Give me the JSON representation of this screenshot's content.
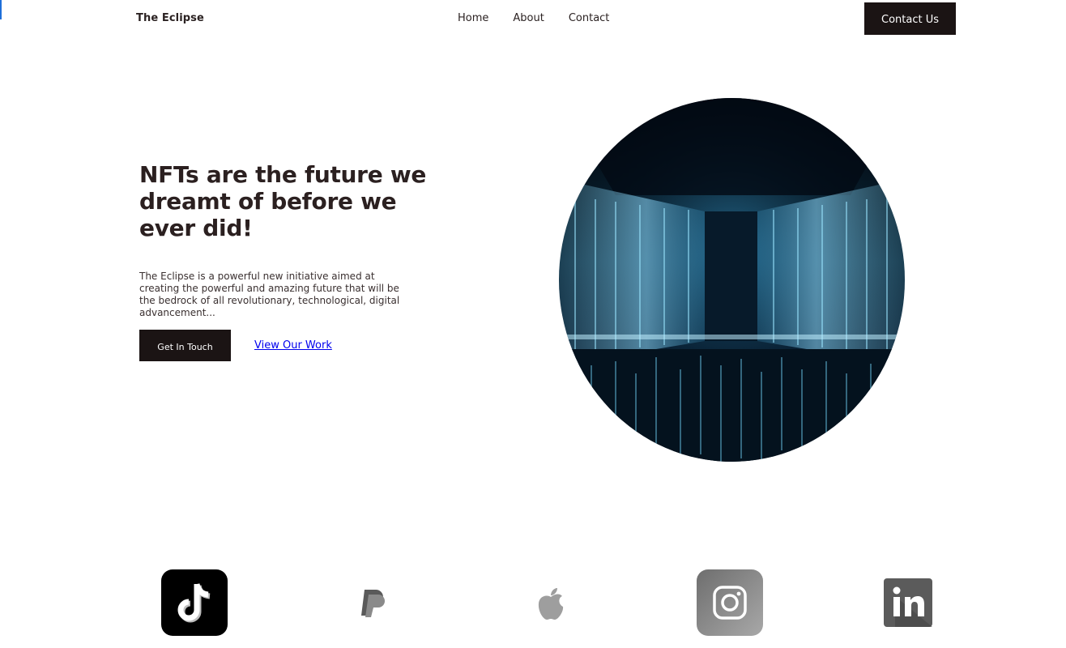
{
  "header": {
    "brand": "The Eclipse",
    "nav": [
      "Home",
      "About",
      "Contact"
    ],
    "contact_button": "Contact Us"
  },
  "hero": {
    "title": "NFTs are the future we dreamt of before we ever did!",
    "description": "The Eclipse is a powerful new initiative aimed at creating the powerful and amazing future that will be the bedrock of all revolutionary, technological, digital advancement...",
    "primary_button": "Get In Touch",
    "secondary_link": "View Our Work",
    "image": "futuristic-light-corridor"
  },
  "partners": [
    {
      "name": "tiktok-logo"
    },
    {
      "name": "paypal-logo"
    },
    {
      "name": "apple-logo"
    },
    {
      "name": "instagram-logo"
    },
    {
      "name": "linkedin-logo"
    }
  ],
  "colors": {
    "dark": "#1b1414",
    "link": "#0000ee",
    "text": "#2b2020",
    "accent_cyan": "#4fc3e8"
  }
}
